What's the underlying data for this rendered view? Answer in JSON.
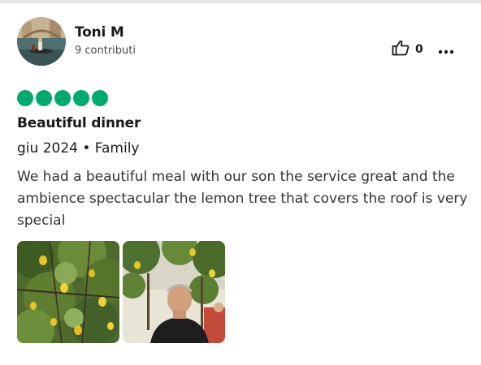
{
  "review": {
    "author": {
      "name": "Toni M",
      "contributions": "9 contributi"
    },
    "helpful_count": "0",
    "rating": {
      "value": 5,
      "max": 5,
      "color": "#00aa6c"
    },
    "title": "Beautiful dinner",
    "meta": "giu 2024 • Family",
    "text": "We had a beautiful meal with our son the service great and the ambience spectacular the lemon tree that covers the roof is very special",
    "photos": [
      {
        "subject": "lemon-tree"
      },
      {
        "subject": "man-under-lemon-trees"
      }
    ]
  },
  "icons": {
    "helpful": "thumbs-up-icon",
    "more": "more-options-icon"
  }
}
